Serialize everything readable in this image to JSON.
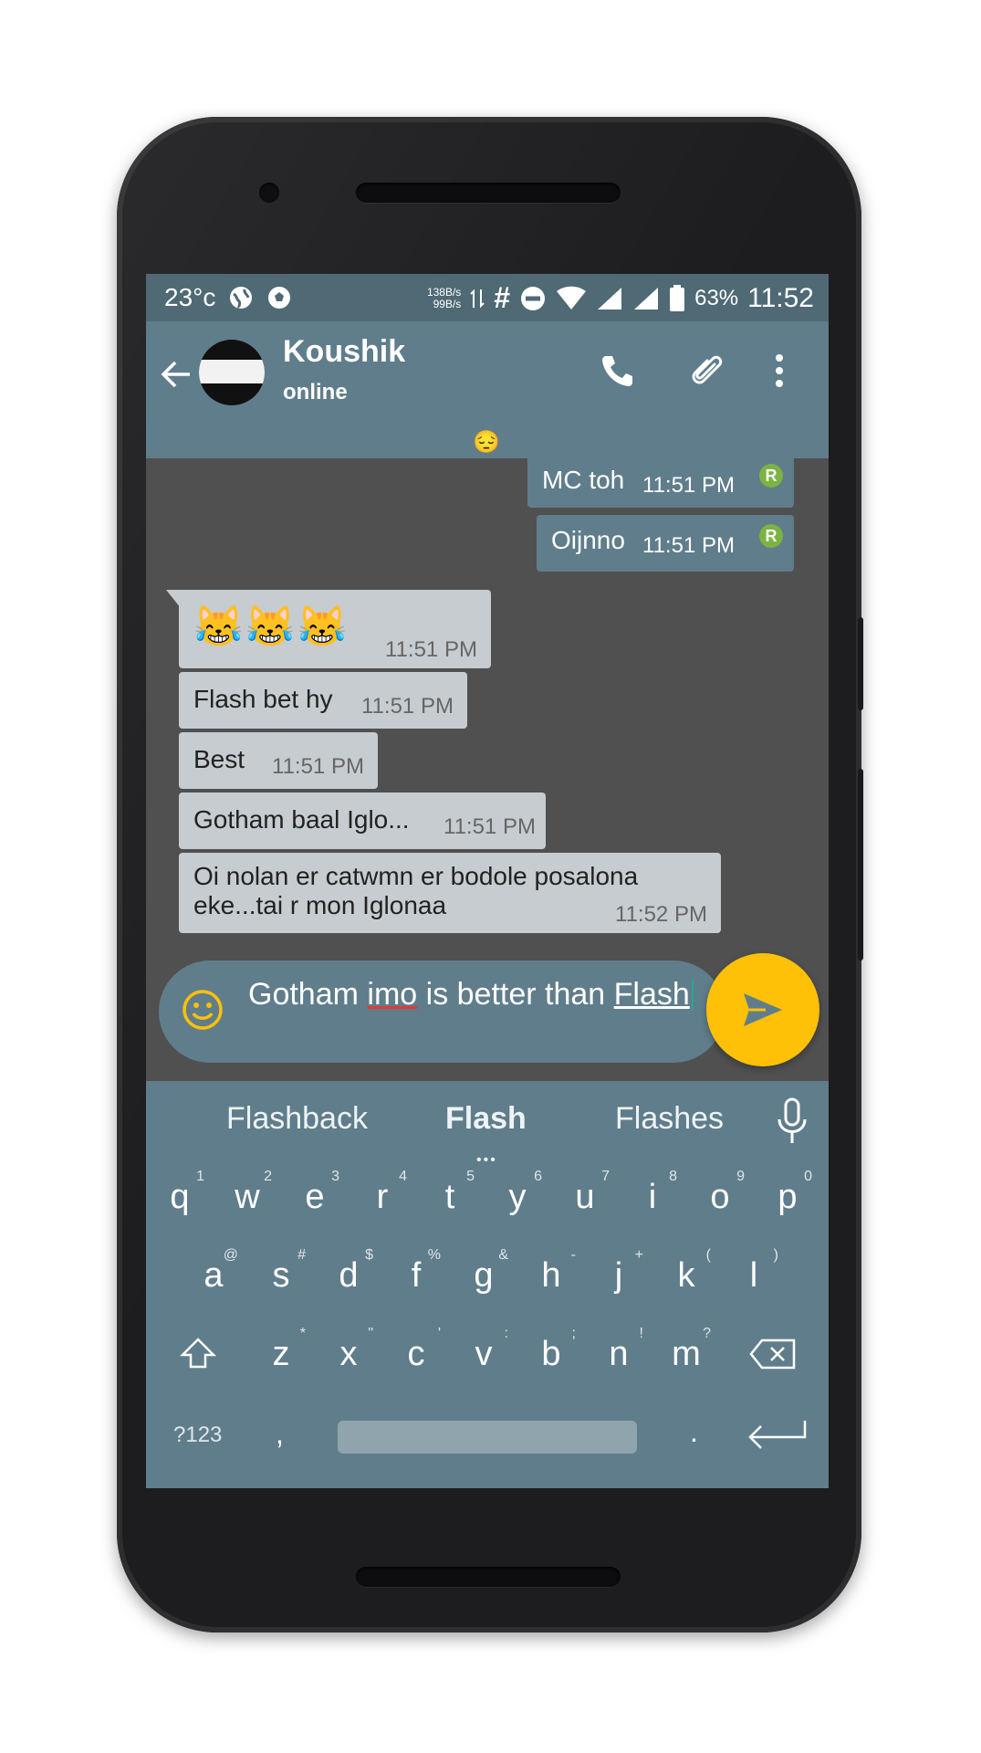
{
  "status_bar": {
    "temperature": "23°c",
    "net_up": "138B/s",
    "net_down": "99B/s",
    "hash": "#",
    "battery": "63%",
    "time": "11:52"
  },
  "chat_header": {
    "name": "Koushik",
    "status": "online"
  },
  "pinned_emoji": "😔",
  "messages": [
    {
      "text": "MC toh",
      "time": "11:51 PM",
      "badge": "R"
    },
    {
      "text": "Oijnno",
      "time": "11:51 PM",
      "badge": "R"
    },
    {
      "text": "😹😹😹",
      "time": "11:51 PM"
    },
    {
      "text": "Flash bet hy",
      "time": "11:51 PM"
    },
    {
      "text": "Best",
      "time": "11:51 PM"
    },
    {
      "text": "Gotham baal Iglo...",
      "time": "11:51 PM"
    },
    {
      "text": "Oi nolan er catwmn er bodole posalona\neke...tai r mon Iglonaa",
      "time": "11:52 PM"
    }
  ],
  "composer": {
    "part1": "Gotham ",
    "part2": "imo",
    "part3": " is better than ",
    "part4": "Flash"
  },
  "keyboard": {
    "suggestions": [
      "Flashback",
      "Flash",
      "Flashes"
    ],
    "row1": [
      "q",
      "w",
      "e",
      "r",
      "t",
      "y",
      "u",
      "i",
      "o",
      "p"
    ],
    "row1_hints": [
      "1",
      "2",
      "3",
      "4",
      "5",
      "6",
      "7",
      "8",
      "9",
      "0"
    ],
    "row2": [
      "a",
      "s",
      "d",
      "f",
      "g",
      "h",
      "j",
      "k",
      "l"
    ],
    "row2_hints": [
      "@",
      "#",
      "$",
      "%",
      "&",
      "-",
      "+",
      "(",
      ")"
    ],
    "row3": [
      "z",
      "x",
      "c",
      "v",
      "b",
      "n",
      "m"
    ],
    "row3_hints": [
      "*",
      "\"",
      "'",
      ":",
      ";",
      "!",
      "?"
    ],
    "symbols_label": "?123",
    "comma": ",",
    "period": "."
  },
  "colors": {
    "primary": "#607d8b",
    "accent": "#ffc107",
    "incoming_bubble": "#c6ccd0",
    "badge": "#7cb342"
  }
}
